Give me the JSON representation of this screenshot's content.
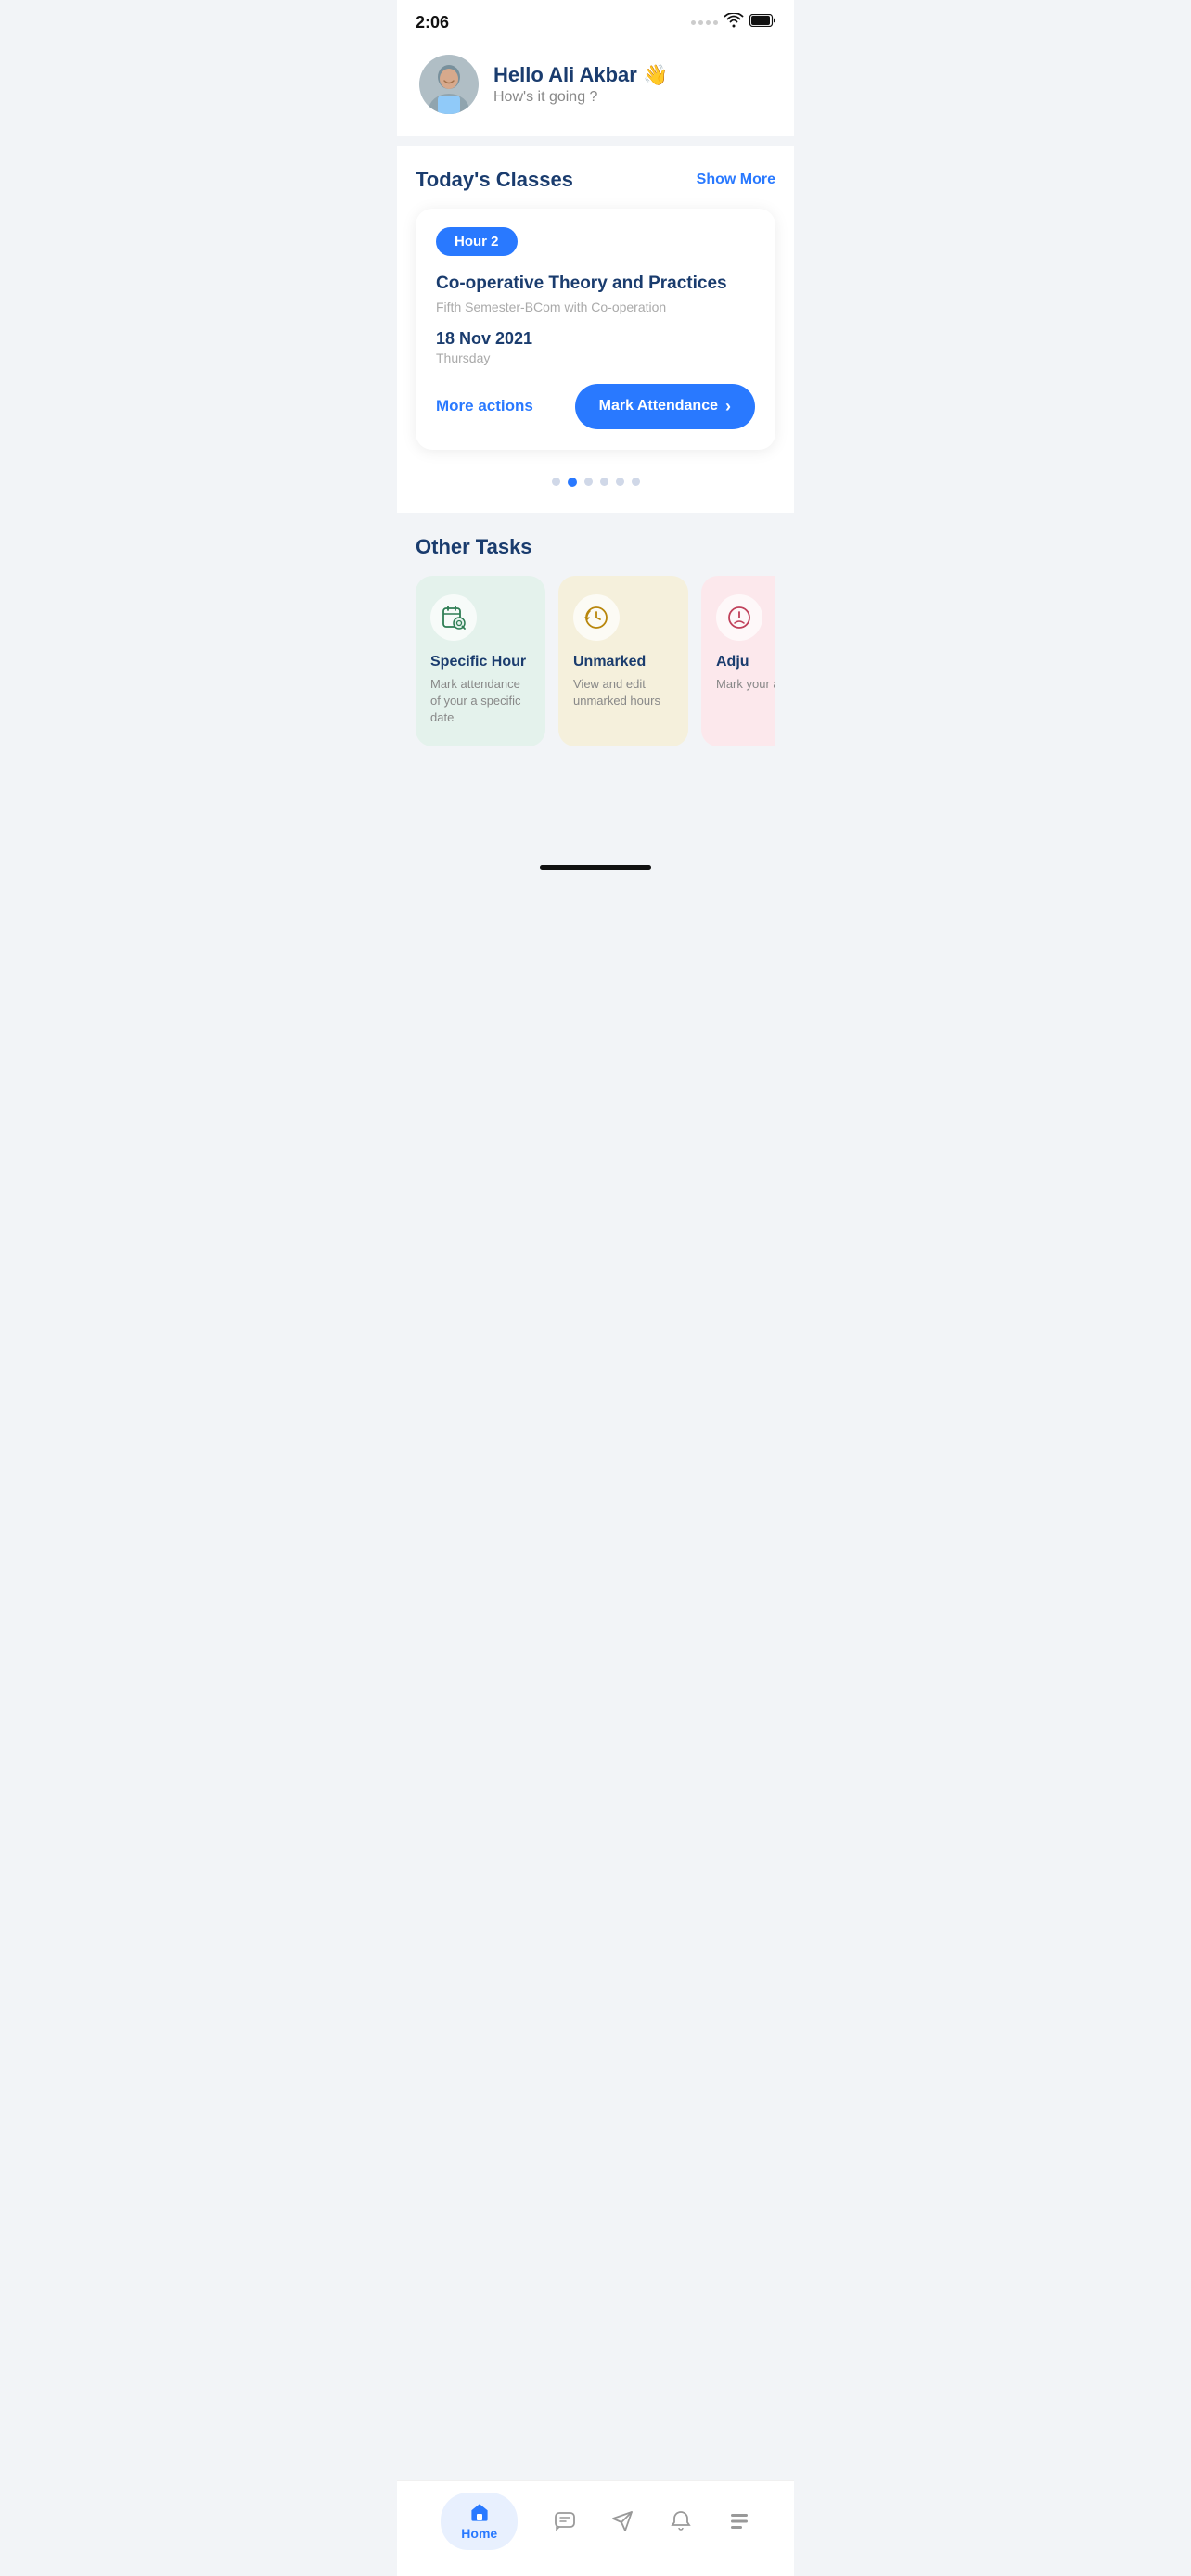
{
  "statusBar": {
    "time": "2:06"
  },
  "header": {
    "greeting": "Hello Ali Akbar 👋",
    "subtext": "How's it going ?"
  },
  "todaysClasses": {
    "title": "Today's Classes",
    "showMore": "Show More",
    "card": {
      "hourBadge": "Hour 2",
      "className": "Co-operative Theory and Practices",
      "classSub": "Fifth Semester-BCom with Co-operation",
      "date": "18 Nov 2021",
      "day": "Thursday",
      "moreActions": "More actions",
      "markAttendance": "Mark Attendance"
    },
    "dots": [
      {
        "active": false
      },
      {
        "active": true
      },
      {
        "active": false
      },
      {
        "active": false
      },
      {
        "active": false
      },
      {
        "active": false
      }
    ]
  },
  "otherTasks": {
    "title": "Other Tasks",
    "tasks": [
      {
        "id": "specific-hour",
        "title": "Specific Hour",
        "desc": "Mark attendance of your a specific date",
        "color": "green",
        "icon": "calendar-search"
      },
      {
        "id": "unmarked",
        "title": "Unmarked",
        "desc": "View and edit unmarked hours",
        "color": "yellow",
        "icon": "clock-history"
      },
      {
        "id": "adjust",
        "title": "Adju",
        "desc": "Mark your a",
        "color": "pink",
        "icon": "clock-adjust"
      }
    ]
  },
  "bottomNav": {
    "items": [
      {
        "id": "home",
        "label": "Home",
        "active": true
      },
      {
        "id": "chat",
        "label": "",
        "active": false
      },
      {
        "id": "send",
        "label": "",
        "active": false
      },
      {
        "id": "bell",
        "label": "",
        "active": false
      },
      {
        "id": "more",
        "label": "",
        "active": false
      }
    ]
  }
}
